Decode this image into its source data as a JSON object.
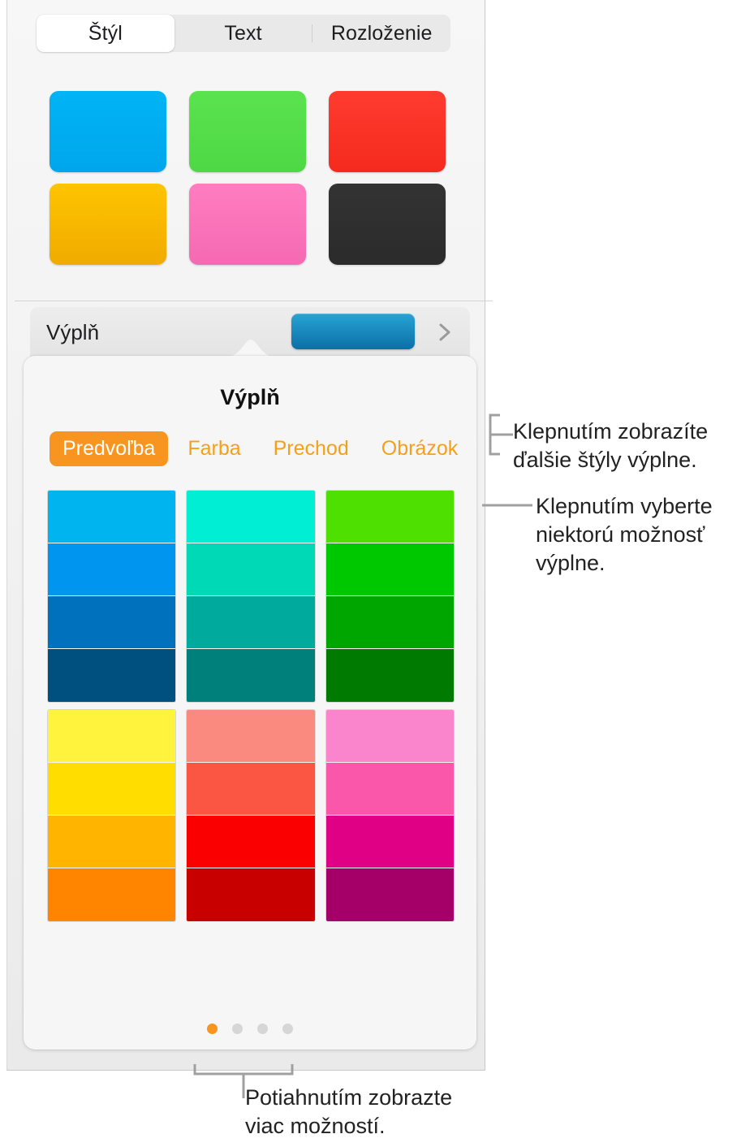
{
  "top_segmented_control": {
    "tabs": [
      {
        "label": "Štýl",
        "selected": true
      },
      {
        "label": "Text",
        "selected": false
      },
      {
        "label": "Rozloženie",
        "selected": false
      }
    ]
  },
  "style_swatches": [
    {
      "name": "style-swatch-blue",
      "top": "#00b4f5",
      "bottom": "#00a6eb"
    },
    {
      "name": "style-swatch-green",
      "top": "#5ae34e",
      "bottom": "#4ed845"
    },
    {
      "name": "style-swatch-red",
      "top": "#ff3b2f",
      "bottom": "#f52a1e"
    },
    {
      "name": "style-swatch-yellow",
      "top": "#ffc400",
      "bottom": "#f0ab00"
    },
    {
      "name": "style-swatch-pink",
      "top": "#ff7dc0",
      "bottom": "#f569b2"
    },
    {
      "name": "style-swatch-black",
      "top": "#333333",
      "bottom": "#2b2b2b"
    }
  ],
  "fill_row": {
    "label": "Výplň",
    "preview_color_top": "#27a3d4",
    "preview_color_bottom": "#0a6fa8",
    "disclosure_icon": "chevron-right-icon"
  },
  "popover": {
    "title": "Výplň",
    "tabs": [
      {
        "label": "Predvoľba",
        "selected": true
      },
      {
        "label": "Farba",
        "selected": false
      },
      {
        "label": "Prechod",
        "selected": false
      },
      {
        "label": "Obrázok",
        "selected": false
      }
    ],
    "accent_color": "#f79520",
    "swatch_blocks": [
      {
        "name": "swatch-block-cool",
        "columns": [
          {
            "name": "swatch-column-blue",
            "cells": [
              "#00b4f0",
              "#0095ef",
              "#0071bc",
              "#00507f"
            ]
          },
          {
            "name": "swatch-column-teal",
            "cells": [
              "#00efd4",
              "#00d9b6",
              "#00aa9c",
              "#00807a"
            ]
          },
          {
            "name": "swatch-column-green",
            "cells": [
              "#4ee000",
              "#00c800",
              "#00a600",
              "#007a00"
            ]
          }
        ]
      },
      {
        "name": "swatch-block-warm",
        "columns": [
          {
            "name": "swatch-column-yellow-orange",
            "cells": [
              "#fff33d",
              "#ffdd00",
              "#ffb400",
              "#ff8400"
            ]
          },
          {
            "name": "swatch-column-red",
            "cells": [
              "#fa8a80",
              "#fb5543",
              "#fb0000",
              "#c90000"
            ]
          },
          {
            "name": "swatch-column-pink-magenta",
            "cells": [
              "#fa85cd",
              "#fa57ab",
              "#e00085",
              "#a50068"
            ]
          }
        ]
      }
    ],
    "page_dots": {
      "count": 4,
      "active_index": 0
    }
  },
  "callouts": [
    {
      "name": "callout-show-more-fill-styles",
      "line1": "Klepnutím zobrazíte",
      "line2": "ďalšie štýly výplne.",
      "leader": "bracket-left-icon"
    },
    {
      "name": "callout-choose-fill-option",
      "line1": "Klepnutím vyberte",
      "line2": "niektorú možnosť",
      "line3": "výplne.",
      "leader": "leader-line-icon"
    },
    {
      "name": "callout-swipe-more-options",
      "line1": "Potiahnutím zobrazte",
      "line2": "viac možností.",
      "leader": "bracket-up-icon"
    }
  ]
}
